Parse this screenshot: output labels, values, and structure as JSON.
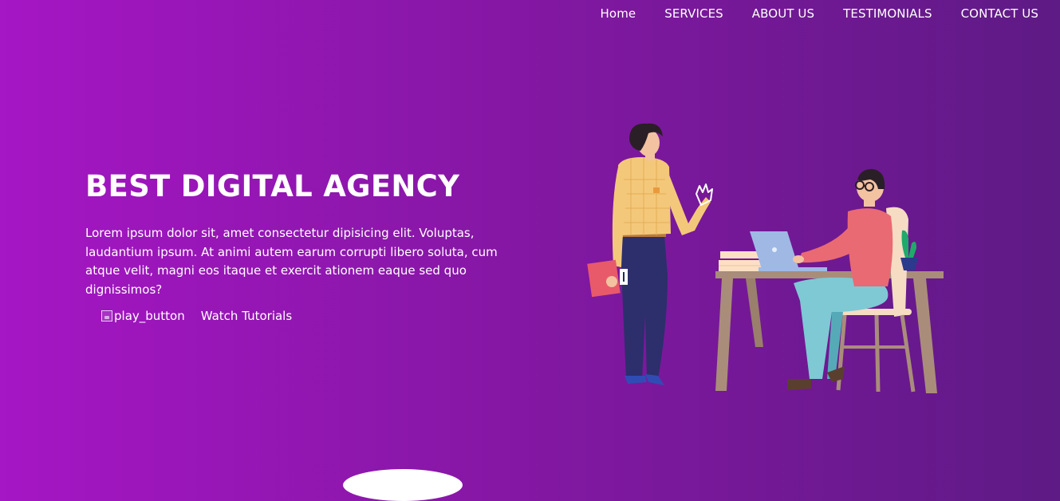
{
  "nav": {
    "items": [
      {
        "label": "Home"
      },
      {
        "label": "SERVICES"
      },
      {
        "label": "ABOUT US"
      },
      {
        "label": "TESTIMONIALS"
      },
      {
        "label": "CONTACT US"
      }
    ]
  },
  "hero": {
    "title": "BEST DIGITAL AGENCY",
    "description": "Lorem ipsum dolor sit, amet consectetur dipisicing elit. Voluptas, laudantium ipsum. At animi autem earum corrupti libero soluta, cum atque velit, magni eos itaque et exercit ationem eaque sed quo dignissimos?",
    "play_button_alt": "play_button",
    "watch_label": "Watch Tutorials",
    "illustration": "office-team-illustration"
  },
  "colors": {
    "gradient_start": "#a516c4",
    "gradient_end": "#5e1a85",
    "text": "#ffffff"
  }
}
